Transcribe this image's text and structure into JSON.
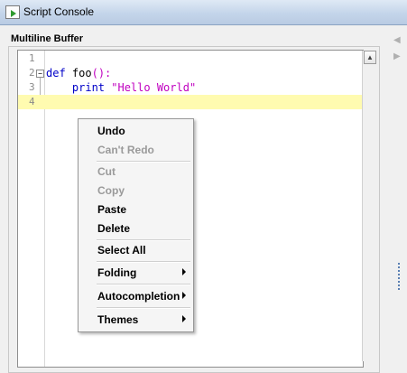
{
  "window": {
    "title": "Script Console"
  },
  "panel": {
    "header": "Multiline Buffer"
  },
  "editor": {
    "lines": [
      {
        "number": "1",
        "tokens": []
      },
      {
        "number": "2",
        "tokens": [
          {
            "text": "def ",
            "style": "kw"
          },
          {
            "text": "foo",
            "style": "plain"
          },
          {
            "text": "():",
            "style": "str"
          }
        ]
      },
      {
        "number": "3",
        "tokens": [
          {
            "text": "    print ",
            "style": "kw"
          },
          {
            "text": "\"Hello World\"",
            "style": "str"
          }
        ]
      },
      {
        "number": "4",
        "tokens": []
      }
    ],
    "current_line": "4"
  },
  "context_menu": {
    "items": [
      {
        "label": "Undo",
        "enabled": true,
        "submenu": false
      },
      {
        "label": "Can't Redo",
        "enabled": false,
        "submenu": false
      },
      {
        "label": "Cut",
        "enabled": false,
        "submenu": false
      },
      {
        "label": "Copy",
        "enabled": false,
        "submenu": false
      },
      {
        "label": "Paste",
        "enabled": true,
        "submenu": false
      },
      {
        "label": "Delete",
        "enabled": true,
        "submenu": false
      },
      {
        "label": "Select All",
        "enabled": true,
        "submenu": false
      },
      {
        "label": "Folding",
        "enabled": true,
        "submenu": true
      },
      {
        "label": "Autocompletion",
        "enabled": true,
        "submenu": true
      },
      {
        "label": "Themes",
        "enabled": true,
        "submenu": true
      }
    ]
  },
  "colors": {
    "keyword": "#0000c8",
    "string": "#c000c0",
    "current_line": "#fffbb0"
  }
}
